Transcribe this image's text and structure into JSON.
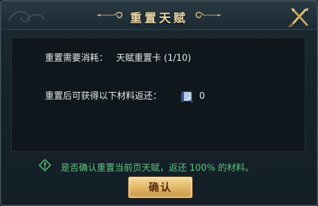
{
  "dialog": {
    "title": "重置天赋",
    "close_icon": "close-icon",
    "cost_label": "重置需要消耗：",
    "cost_value": "天赋重置卡 (1/10)",
    "return_label": "重置后可获得以下材料返还：",
    "return_item_icon": "scroll-book-icon",
    "return_item_count": "0",
    "confirm_message": "是否确认重置当前页天赋，返还 100% 的材料。",
    "confirm_icon": "warning-icon",
    "confirm_button_label": "确认"
  },
  "colors": {
    "title": "#e9d6a6",
    "message": "#5cc57e",
    "button_text": "#5a2a12",
    "button_gold": "#e3b868"
  }
}
